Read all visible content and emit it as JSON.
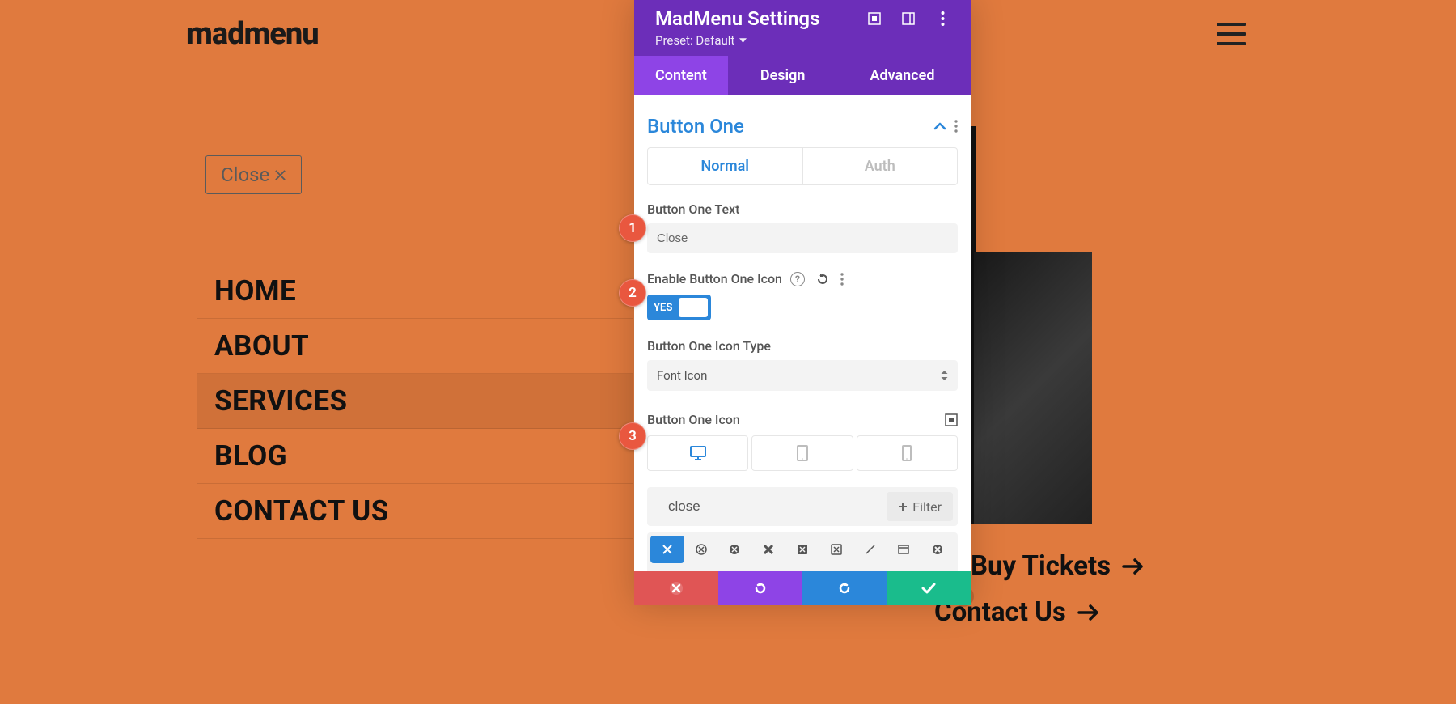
{
  "logo": "madmenu",
  "preview": {
    "close_label": "Close"
  },
  "menu": {
    "items": [
      "HOME",
      "ABOUT",
      "SERVICES",
      "BLOG",
      "CONTACT US"
    ],
    "active_index": 2
  },
  "cta": {
    "tickets": "Buy Tickets",
    "contact": "Contact Us"
  },
  "panel": {
    "title": "MadMenu Settings",
    "preset": "Preset: Default",
    "tabs": {
      "content": "Content",
      "design": "Design",
      "advanced": "Advanced",
      "active": "content"
    },
    "section": {
      "title": "Button One",
      "pill_normal": "Normal",
      "pill_auth": "Auth",
      "button_text_label": "Button One Text",
      "button_text_value": "Close",
      "enable_icon_label": "Enable Button One Icon",
      "toggle_label": "YES",
      "icon_type_label": "Button One Icon Type",
      "icon_type_value": "Font Icon",
      "icon_label": "Button One Icon",
      "icon_search_value": "close",
      "filter_label": "Filter"
    }
  },
  "badges": {
    "b1": "1",
    "b2": "2",
    "b3": "3"
  }
}
